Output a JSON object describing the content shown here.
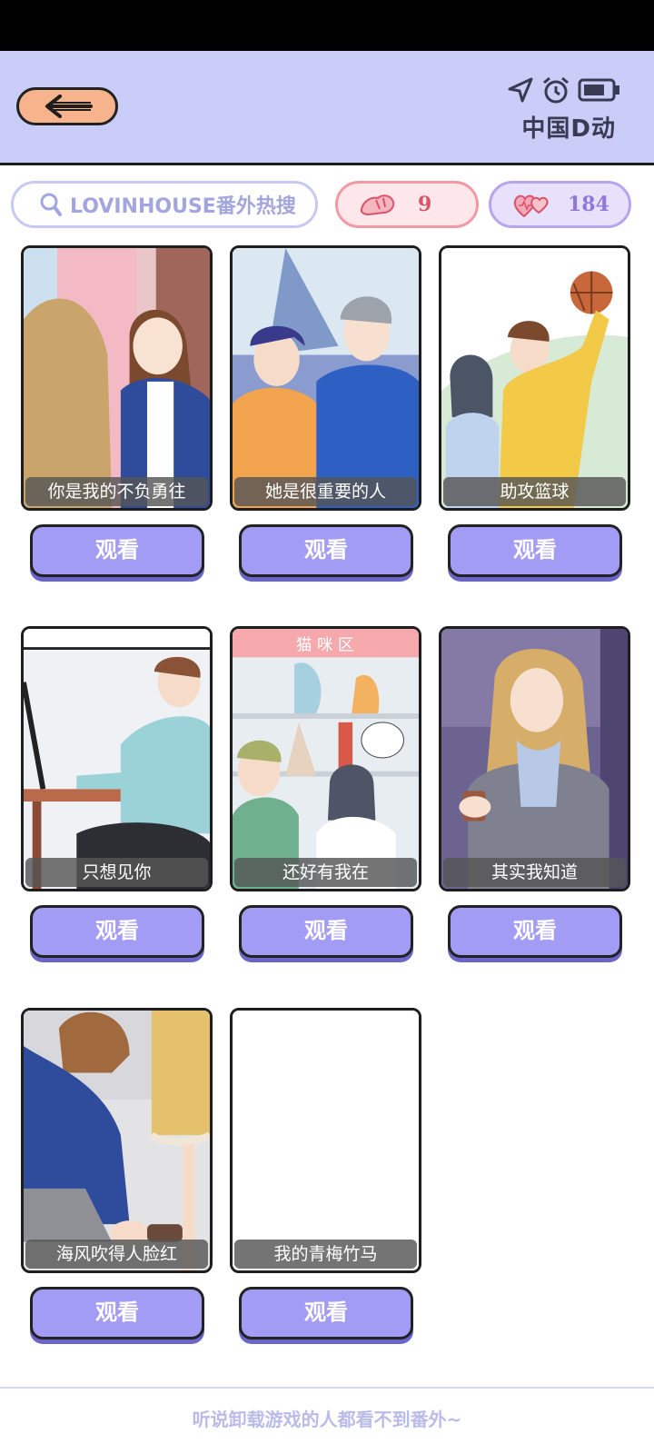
{
  "header": {
    "back_icon": "back-arrow-icon",
    "icons": [
      "location-arrow-icon",
      "alarm-clock-icon",
      "battery-icon"
    ],
    "subtitle": "中国D动"
  },
  "search": {
    "placeholder": "LOVINHOUSE番外热搜",
    "icon": "search-icon"
  },
  "stats": {
    "hands_count": "9",
    "hearts_count": "184"
  },
  "cards": [
    {
      "title": "你是我的不负勇往",
      "button": "观看"
    },
    {
      "title": "她是很重要的人",
      "button": "观看"
    },
    {
      "title": "助攻篮球",
      "button": "观看"
    },
    {
      "title": "只想见你",
      "button": "观看"
    },
    {
      "title": "还好有我在",
      "button": "观看"
    },
    {
      "title": "其实我知道",
      "button": "观看"
    },
    {
      "title": "海风吹得人脸红",
      "button": "观看"
    },
    {
      "title": "我的青梅竹马",
      "button": "观看"
    }
  ],
  "footer": {
    "note": "听说卸载游戏的人都看不到番外~"
  },
  "colors": {
    "header_bg": "#c9cdf8",
    "button_bg": "#a29cf4",
    "back_button_bg": "#f7b48c",
    "pill_pink": "#fde7ea",
    "pill_purple": "#e7e1fb"
  }
}
